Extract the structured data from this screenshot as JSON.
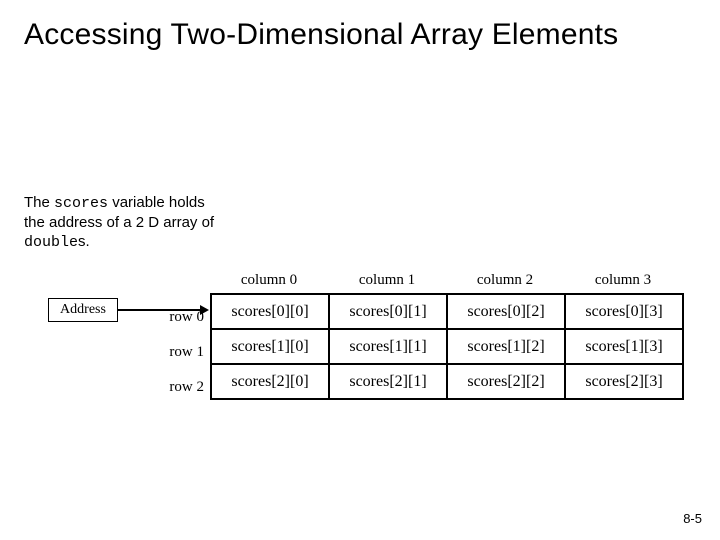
{
  "title": "Accessing Two-Dimensional Array Elements",
  "caption_parts": {
    "p1": "The ",
    "scores": "scores",
    "p2": " variable holds the address of a 2 D array of ",
    "doubles": "double",
    "p3": "s."
  },
  "address_label": "Address",
  "col_headers": [
    "column 0",
    "column 1",
    "column 2",
    "column 3"
  ],
  "row_headers": [
    "row 0",
    "row 1",
    "row 2"
  ],
  "cells": [
    [
      "scores[0][0]",
      "scores[0][1]",
      "scores[0][2]",
      "scores[0][3]"
    ],
    [
      "scores[1][0]",
      "scores[1][1]",
      "scores[1][2]",
      "scores[1][3]"
    ],
    [
      "scores[2][0]",
      "scores[2][1]",
      "scores[2][2]",
      "scores[2][3]"
    ]
  ],
  "footer": "8-5"
}
